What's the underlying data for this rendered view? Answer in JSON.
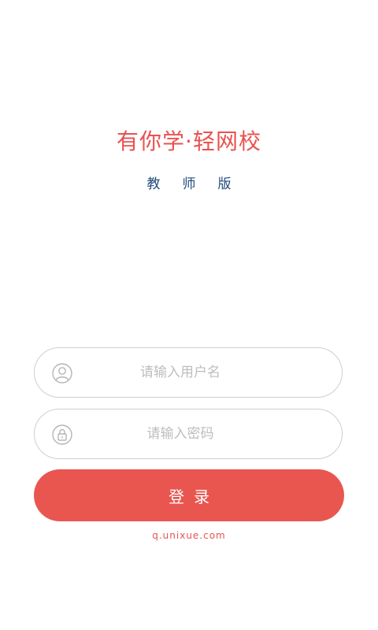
{
  "app": {
    "logo_text": "有你学·轻网校",
    "subtitle": "教师版",
    "brand_color": "#e8524f",
    "subtitle_color": "#1f4a7a"
  },
  "login_form": {
    "username_placeholder": "请输入用户名",
    "username_icon": "user-icon",
    "password_placeholder": "请输入密码",
    "password_icon": "lock-icon",
    "submit_label": "登录",
    "submit_color": "#e8564f"
  },
  "footer": {
    "site_link": "q.unixue.com"
  }
}
